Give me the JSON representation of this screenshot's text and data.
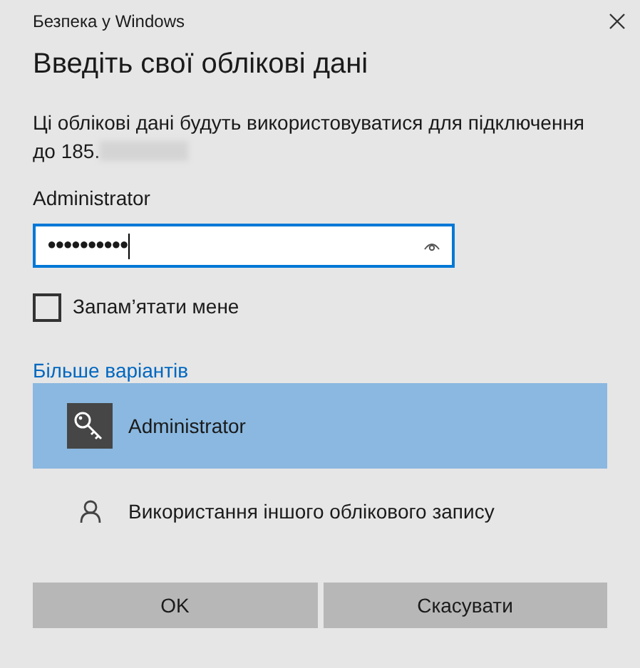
{
  "window": {
    "title": "Безпека у Windows"
  },
  "heading": "Введіть свої облікові дані",
  "description": [
    "Ці облікові дані будуть використовуватися для підключення",
    "до 185."
  ],
  "username": "Administrator",
  "password": {
    "value": "●●●●●●●●●●",
    "focused": true
  },
  "remember": {
    "label": "Запам’ятати мене",
    "checked": false
  },
  "more_options": "Більше варіантів",
  "accounts": [
    {
      "kind": "key",
      "label": "Administrator",
      "selected": true
    },
    {
      "kind": "person",
      "label": "Використання іншого облікового запису",
      "selected": false
    }
  ],
  "buttons": [
    "OK",
    "Скасувати"
  ]
}
